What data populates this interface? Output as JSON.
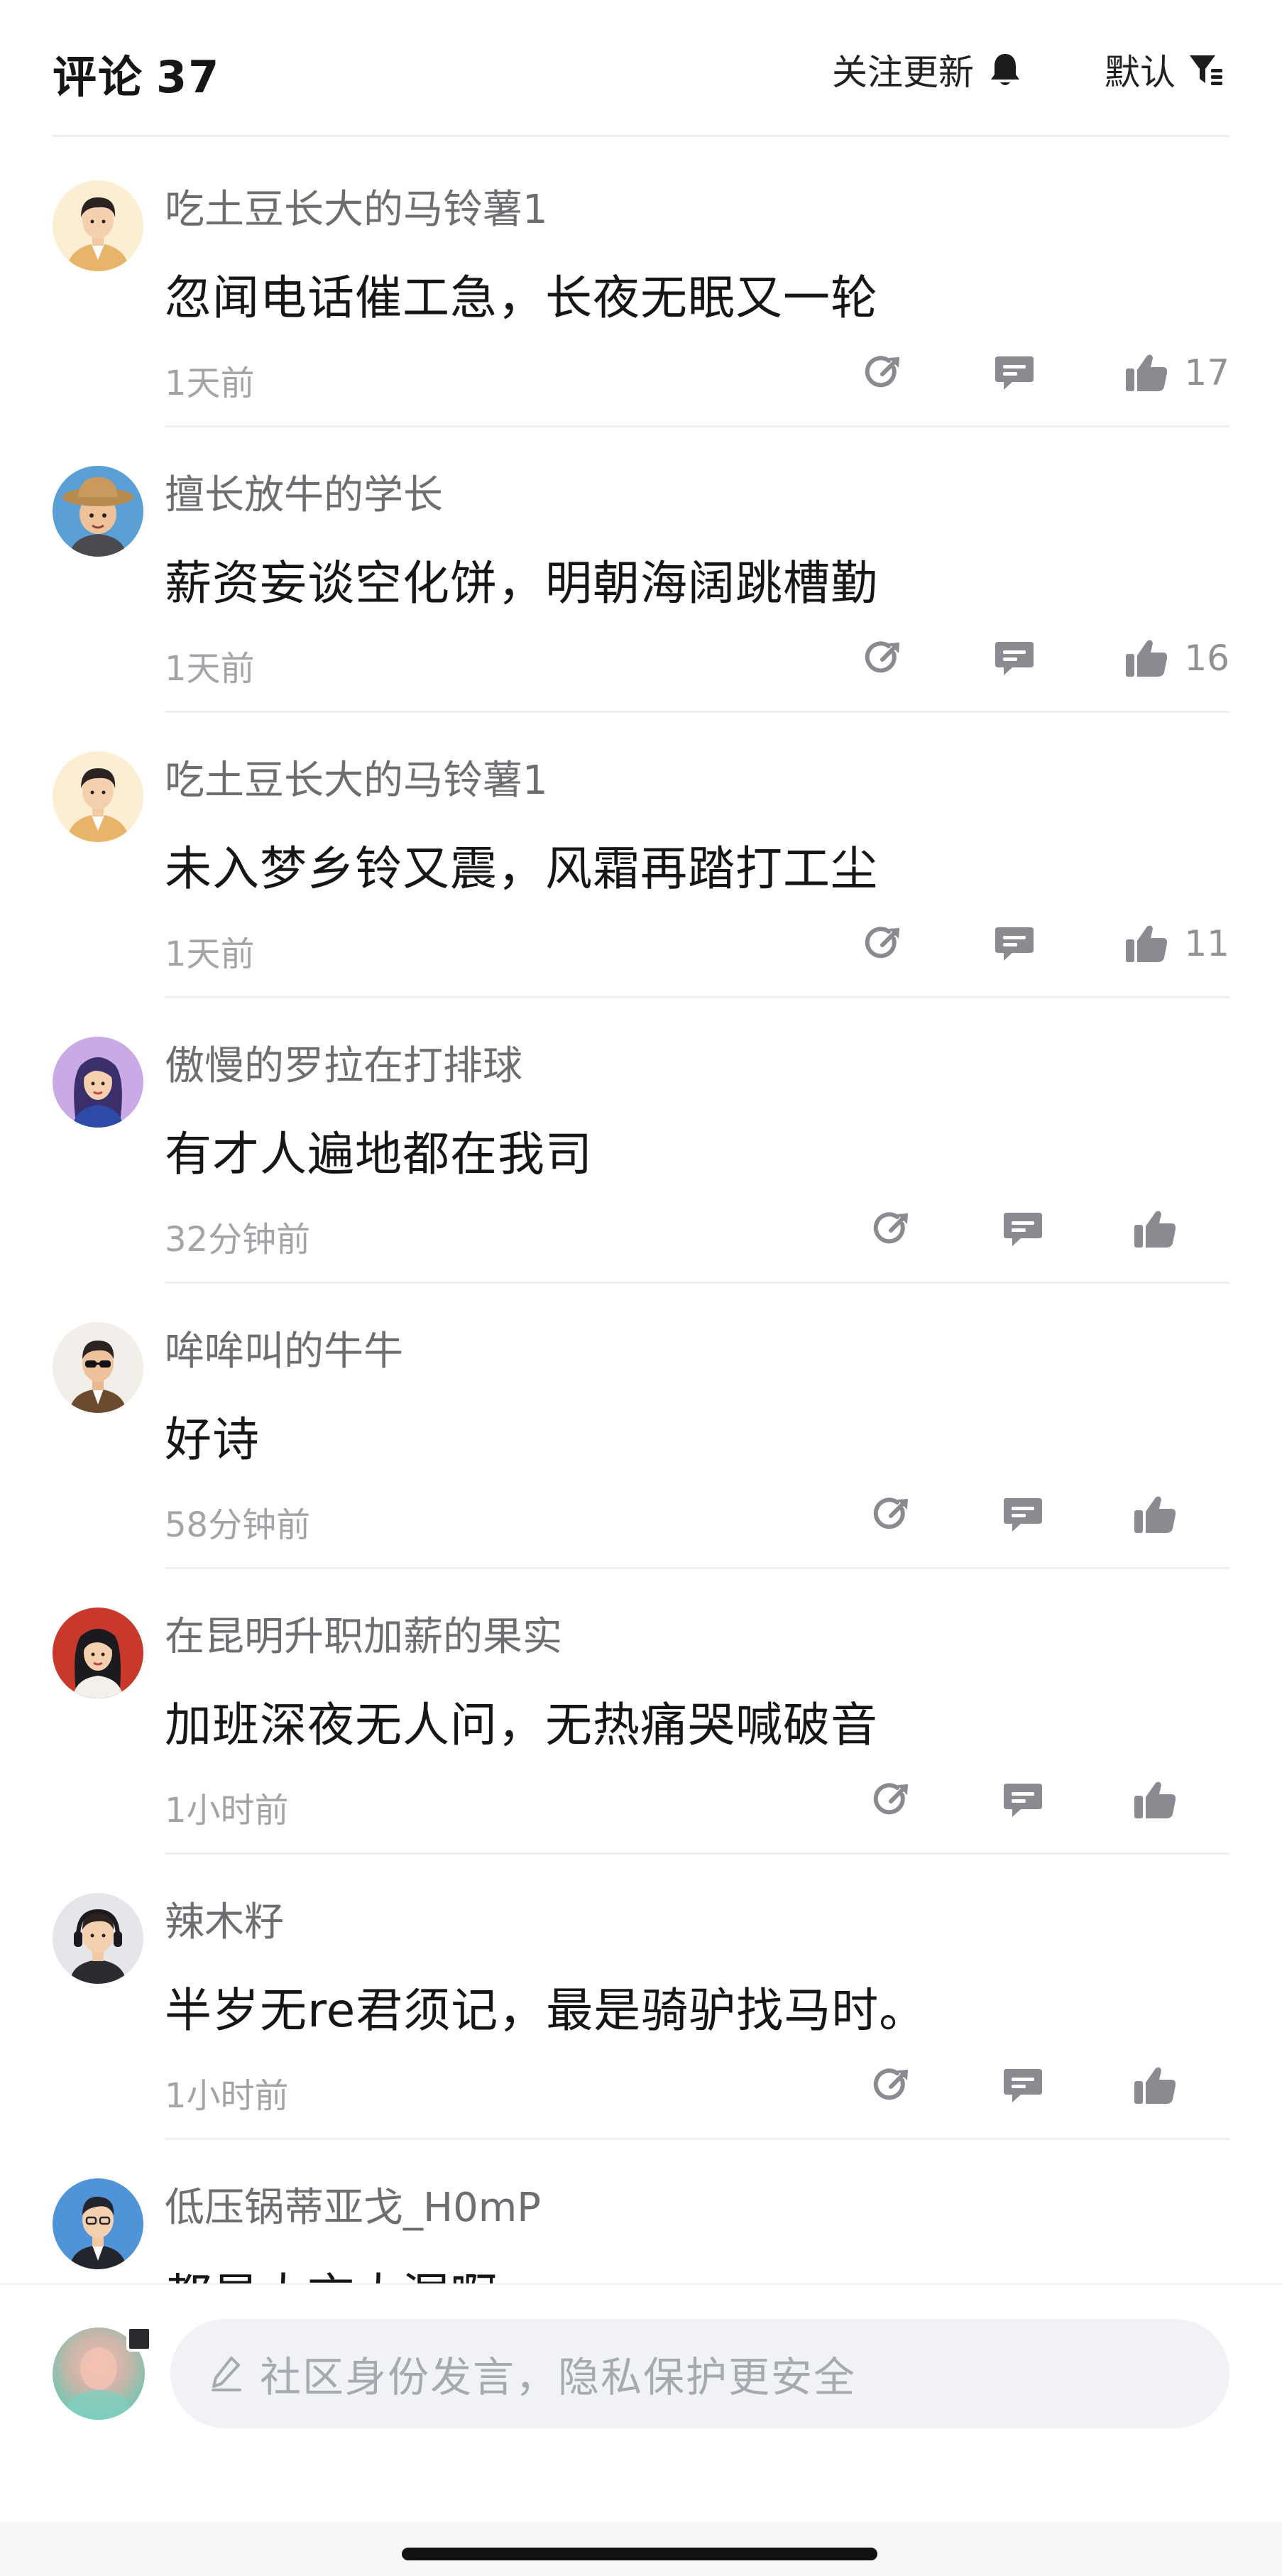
{
  "header": {
    "title": "评论",
    "count": "37",
    "follow_label": "关注更新",
    "follow_icon": "bell-icon",
    "sort_label": "默认",
    "sort_icon": "filter-icon"
  },
  "comments": [
    {
      "username": "吃土豆长大的马铃薯1",
      "text": "忽闻电话催工急，长夜无眠又一轮",
      "time": "1天前",
      "likes": "17",
      "avatar": "man-beige"
    },
    {
      "username": "擅长放牛的学长",
      "text": "薪资妄谈空化饼，明朝海阔跳槽勤",
      "time": "1天前",
      "likes": "16",
      "avatar": "straw-hat-boy"
    },
    {
      "username": "吃土豆长大的马铃薯1",
      "text": "未入梦乡铃又震，风霜再踏打工尘",
      "time": "1天前",
      "likes": "11",
      "avatar": "man-beige"
    },
    {
      "username": "傲慢的罗拉在打排球",
      "text": "有才人遍地都在我司",
      "time": "32分钟前",
      "likes": "",
      "avatar": "woman-purple"
    },
    {
      "username": "哞哞叫的牛牛",
      "text": "好诗",
      "time": "58分钟前",
      "likes": "",
      "avatar": "man-sunglasses"
    },
    {
      "username": "在昆明升职加薪的果实",
      "text": "加班深夜无人问，无热痛哭喊破音",
      "time": "1小时前",
      "likes": "",
      "avatar": "woman-red"
    },
    {
      "username": "辣木籽",
      "text": "半岁无re君须记，最是骑驴找马时。",
      "time": "1小时前",
      "likes": "",
      "avatar": "man-headphones"
    },
    {
      "username": "低压锅蒂亚戈_H0mP",
      "text": "都是大言大漏啊",
      "time": "",
      "likes": "",
      "avatar": "man-blue"
    }
  ],
  "action_icons": {
    "share": "share-icon",
    "reply": "reply-icon",
    "like": "thumbs-up-icon"
  },
  "input": {
    "placeholder": "社区身份发言，隐私保护更安全",
    "icon": "pen-icon"
  },
  "colors": {
    "username": "#6d6e72",
    "time": "#a3a4a8",
    "icon": "#8a8b90",
    "input_bg": "#f1f2f6"
  }
}
